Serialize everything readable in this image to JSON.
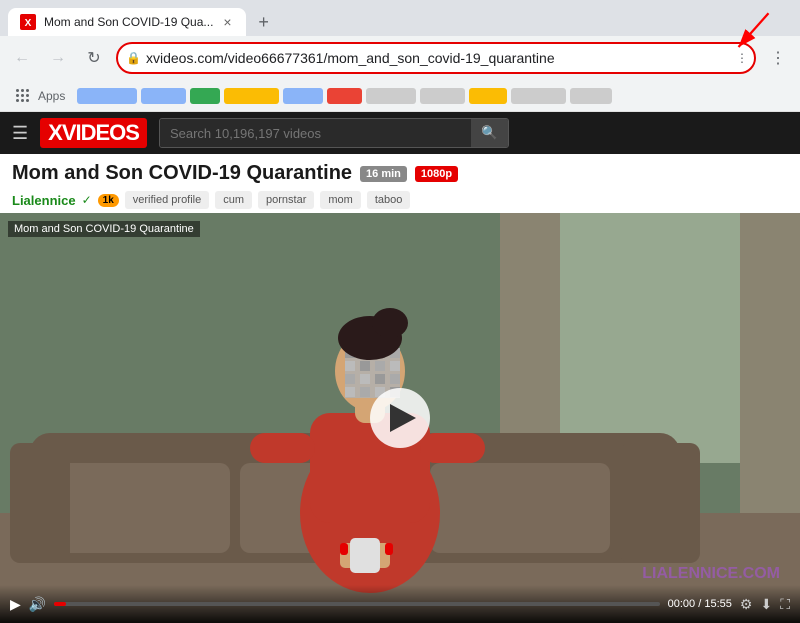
{
  "browser": {
    "tab_title": "Mom and Son COVID-19 Qua...",
    "tab_favicon": "▶",
    "new_tab_btn": "+",
    "address_url": "xvideos.com/video66677361/mom_and_son_covid-19_quarantine",
    "back_btn": "←",
    "forward_btn": "→",
    "refresh_btn": "↻",
    "nav_extra_dots": "⋮",
    "bookmarks_apps_label": "Apps"
  },
  "header": {
    "menu_icon": "☰",
    "logo": "XVIDEOS",
    "search_placeholder": "Search 10,196,197 videos",
    "search_icon": "🔍"
  },
  "video": {
    "title": "Mom and Son COVID-19 Quarantine",
    "duration_badge": "16 min",
    "quality_badge": "1080p",
    "channel_name": "Lialennice",
    "verified_label": "✓",
    "subscriber_count": "1k",
    "tags": [
      "verified profile",
      "cum",
      "pornstar",
      "mom",
      "taboo"
    ],
    "overlay_title": "Mom and Son COVID-19 Quarantine",
    "play_button_label": "▶",
    "watermark": "LIALENNICE.COM",
    "time_current": "00:00",
    "time_total": "15:55"
  },
  "bookmarks": {
    "items_colors": [
      "#8ab4f8",
      "#8ab4f8",
      "#34a853",
      "#fbbc04",
      "#ea4335",
      "#8ab4f8",
      "#ccc",
      "#ccc",
      "#ccc",
      "#ccc"
    ]
  }
}
